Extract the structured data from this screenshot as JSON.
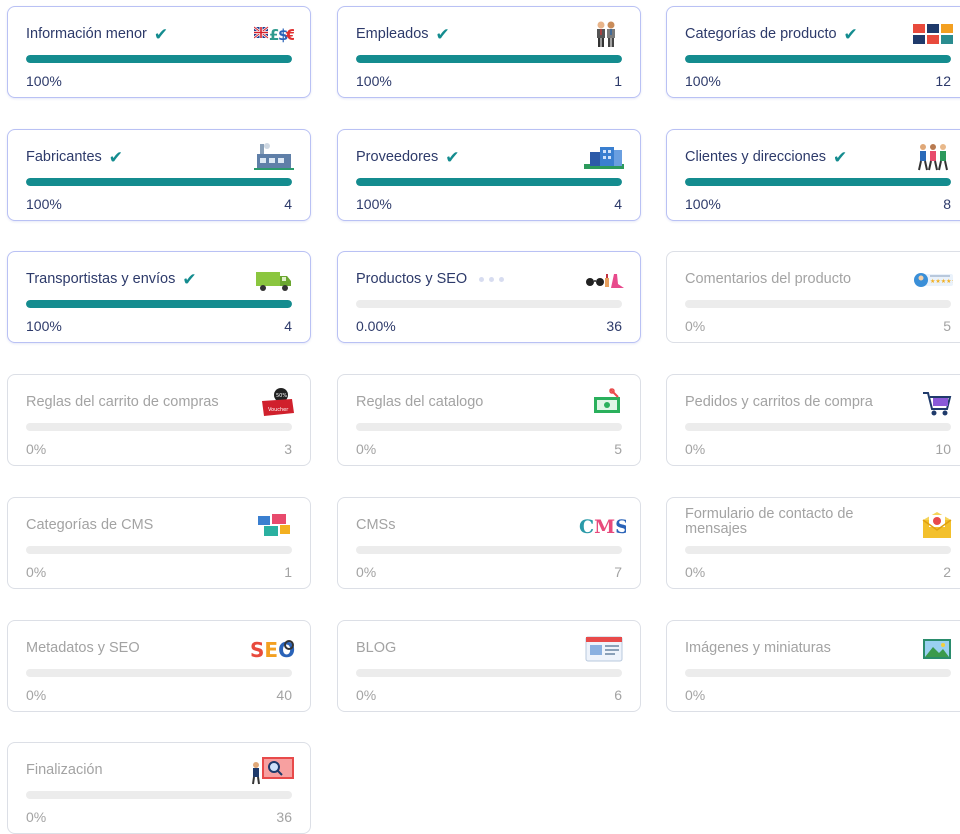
{
  "colors": {
    "accent": "#148c8f",
    "border_active": "#b9c1f4",
    "text_active": "#2d3a6a",
    "text_muted": "#a3a3a3"
  },
  "cards": [
    {
      "title": "Información menor",
      "status": "complete",
      "percent": "100%",
      "progress": 1,
      "count": "",
      "icon": "currency-flags-icon"
    },
    {
      "title": "Empleados",
      "status": "complete",
      "percent": "100%",
      "progress": 1,
      "count": "1",
      "icon": "employees-icon"
    },
    {
      "title": "Categorías de producto",
      "status": "complete",
      "percent": "100%",
      "progress": 1,
      "count": "12",
      "icon": "category-grid-icon"
    },
    {
      "title": "Fabricantes",
      "status": "complete",
      "percent": "100%",
      "progress": 1,
      "count": "4",
      "icon": "factory-icon"
    },
    {
      "title": "Proveedores",
      "status": "complete",
      "percent": "100%",
      "progress": 1,
      "count": "4",
      "icon": "building-icon"
    },
    {
      "title": "Clientes y direcciones",
      "status": "complete",
      "percent": "100%",
      "progress": 1,
      "count": "8",
      "icon": "customers-icon"
    },
    {
      "title": "Transportistas y envíos",
      "status": "complete",
      "percent": "100%",
      "progress": 1,
      "count": "4",
      "icon": "truck-icon"
    },
    {
      "title": "Productos y SEO",
      "status": "in-progress",
      "percent": "0.00%",
      "progress": 0,
      "count": "36",
      "icon": "products-icon"
    },
    {
      "title": "Comentarios del producto",
      "status": "pending",
      "percent": "0%",
      "progress": 0,
      "count": "5",
      "icon": "reviews-icon"
    },
    {
      "title": "Reglas del carrito de compras",
      "status": "pending",
      "percent": "0%",
      "progress": 0,
      "count": "3",
      "icon": "voucher-icon"
    },
    {
      "title": "Reglas del catalogo",
      "status": "pending",
      "percent": "0%",
      "progress": 0,
      "count": "5",
      "icon": "price-tag-icon"
    },
    {
      "title": "Pedidos y carritos de compra",
      "status": "pending",
      "percent": "0%",
      "progress": 0,
      "count": "10",
      "icon": "cart-icon"
    },
    {
      "title": "Categorías de CMS",
      "status": "pending",
      "percent": "0%",
      "progress": 0,
      "count": "1",
      "icon": "cms-categories-icon"
    },
    {
      "title": "CMSs",
      "status": "pending",
      "percent": "0%",
      "progress": 0,
      "count": "7",
      "icon": "cms-text-icon",
      "icon_text": "CMS"
    },
    {
      "title": "Formulario de contacto de mensajes",
      "status": "pending",
      "percent": "0%",
      "progress": 0,
      "count": "2",
      "icon": "envelope-icon"
    },
    {
      "title": "Metadatos y SEO",
      "status": "pending",
      "percent": "0%",
      "progress": 0,
      "count": "40",
      "icon": "seo-icon",
      "icon_text": "SEO"
    },
    {
      "title": "BLOG",
      "status": "pending",
      "percent": "0%",
      "progress": 0,
      "count": "6",
      "icon": "blog-icon"
    },
    {
      "title": "Imágenes y miniaturas",
      "status": "pending",
      "percent": "0%",
      "progress": 0,
      "count": "",
      "icon": "image-icon"
    },
    {
      "title": "Finalización",
      "status": "pending",
      "percent": "0%",
      "progress": 0,
      "count": "36",
      "icon": "finalization-icon"
    }
  ]
}
